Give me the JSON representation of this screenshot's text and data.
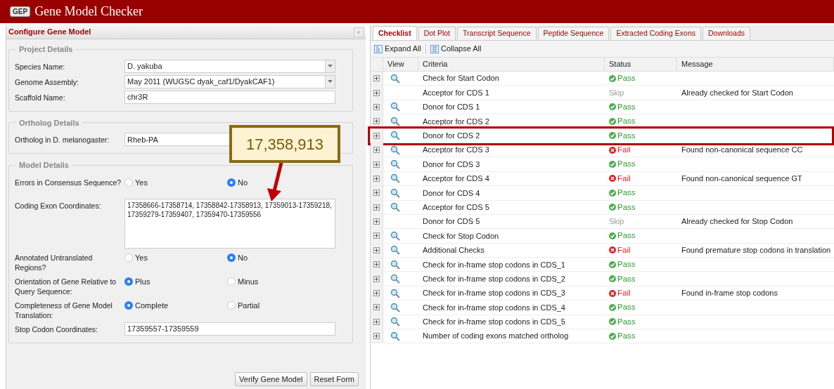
{
  "app": {
    "logo": "GEP",
    "title": "Gene Model Checker"
  },
  "left_panel": {
    "title": "Configure Gene Model",
    "collapse": "«",
    "sections": [
      {
        "legend": "Project Details",
        "fields": [
          {
            "kind": "select",
            "label": "Species Name:",
            "value": "D. yakuba"
          },
          {
            "kind": "select",
            "label": "Genome Assembly:",
            "value": "May 2011 (WUGSC dyak_caf1/DyakCAF1)"
          },
          {
            "kind": "text",
            "label": "Scaffold Name:",
            "value": "chr3R"
          }
        ]
      },
      {
        "legend": "Ortholog Details",
        "fields": [
          {
            "kind": "text",
            "label": "Ortholog in D. melanogaster:",
            "value": "Rheb-PA"
          }
        ]
      },
      {
        "legend": "Model Details",
        "fields": [
          {
            "kind": "radio",
            "label": "Errors in Consensus Sequence?",
            "options": [
              {
                "label": "Yes",
                "selected": false
              },
              {
                "label": "No",
                "selected": true
              }
            ]
          },
          {
            "kind": "textarea",
            "label": "Coding Exon Coordinates:",
            "value": "17358666-17358714, 17358842-17358913, 17359013-17359218, 17359279-17359407, 17359470-17359556"
          },
          {
            "kind": "radio",
            "label": "Annotated Untranslated Regions?",
            "options": [
              {
                "label": "Yes",
                "selected": false
              },
              {
                "label": "No",
                "selected": true
              }
            ]
          },
          {
            "kind": "radio",
            "label": "Orientation of Gene Relative to Query Sequence:",
            "options": [
              {
                "label": "Plus",
                "selected": true
              },
              {
                "label": "Minus",
                "selected": false
              }
            ]
          },
          {
            "kind": "radio",
            "label": "Completeness of Gene Model Translation:",
            "options": [
              {
                "label": "Complete",
                "selected": true
              },
              {
                "label": "Partial",
                "selected": false
              }
            ]
          },
          {
            "kind": "text",
            "label": "Stop Codon Coordinates:",
            "value": "17359557-17359559"
          }
        ]
      }
    ],
    "buttons": [
      "Verify Gene Model",
      "Reset Form"
    ]
  },
  "callout": {
    "text": "17,358,913"
  },
  "tabs": [
    {
      "label": "Checklist",
      "selected": true
    },
    {
      "label": "Dot Plot",
      "selected": false
    },
    {
      "label": "Transcript Sequence",
      "selected": false
    },
    {
      "label": "Peptide Sequence",
      "selected": false
    },
    {
      "label": "Extracted Coding Exons",
      "selected": false
    },
    {
      "label": "Downloads",
      "selected": false
    }
  ],
  "toolbar": [
    "Expand All",
    "Collapse All"
  ],
  "table": {
    "columns": [
      "View",
      "Criteria",
      "Status",
      "Message"
    ],
    "rows": [
      {
        "view": true,
        "criteria": "Check for Start Codon",
        "status": "Pass",
        "kind": "pass",
        "highlighted": false
      },
      {
        "view": false,
        "criteria": "Acceptor for CDS 1",
        "status": "Skip",
        "kind": "skip",
        "message": "Already checked for Start Codon",
        "highlighted": false
      },
      {
        "view": true,
        "criteria": "Donor for CDS 1",
        "status": "Pass",
        "kind": "pass",
        "highlighted": false
      },
      {
        "view": true,
        "criteria": "Acceptor for CDS 2",
        "status": "Pass",
        "kind": "pass",
        "highlighted": false
      },
      {
        "view": true,
        "criteria": "Donor for CDS 2",
        "status": "Pass",
        "kind": "pass",
        "highlighted": true
      },
      {
        "view": true,
        "criteria": "Acceptor for CDS 3",
        "status": "Fail",
        "kind": "fail",
        "message": "Found non-canonical sequence CC",
        "highlighted": false
      },
      {
        "view": true,
        "criteria": "Donor for CDS 3",
        "status": "Pass",
        "kind": "pass",
        "highlighted": false
      },
      {
        "view": true,
        "criteria": "Acceptor for CDS 4",
        "status": "Fail",
        "kind": "fail",
        "message": "Found non-canonical sequence GT",
        "highlighted": false
      },
      {
        "view": true,
        "criteria": "Donor for CDS 4",
        "status": "Pass",
        "kind": "pass",
        "highlighted": false
      },
      {
        "view": true,
        "criteria": "Acceptor for CDS 5",
        "status": "Pass",
        "kind": "pass",
        "highlighted": false
      },
      {
        "view": false,
        "criteria": "Donor for CDS 5",
        "status": "Skip",
        "kind": "skip",
        "message": "Already checked for Stop Codon",
        "highlighted": false
      },
      {
        "view": true,
        "criteria": "Check for Stop Codon",
        "status": "Pass",
        "kind": "pass",
        "highlighted": false
      },
      {
        "view": true,
        "criteria": "Additional Checks",
        "status": "Fail",
        "kind": "fail",
        "message": "Found premature stop codons in translation",
        "highlighted": false
      },
      {
        "view": true,
        "criteria": "Check for in-frame stop codons in CDS_1",
        "status": "Pass",
        "kind": "pass",
        "highlighted": false
      },
      {
        "view": true,
        "criteria": "Check for in-frame stop codons in CDS_2",
        "status": "Pass",
        "kind": "pass",
        "highlighted": false
      },
      {
        "view": true,
        "criteria": "Check for in-frame stop codons in CDS_3",
        "status": "Fail",
        "kind": "fail",
        "message": "Found in-frame stop codons",
        "highlighted": false
      },
      {
        "view": true,
        "criteria": "Check for in-frame stop codons in CDS_4",
        "status": "Pass",
        "kind": "pass",
        "highlighted": false
      },
      {
        "view": true,
        "criteria": "Check for in-frame stop codons in CDS_5",
        "status": "Pass",
        "kind": "pass",
        "highlighted": false
      },
      {
        "view": true,
        "criteria": "Number of coding exons matched ortholog",
        "status": "Pass",
        "kind": "pass",
        "highlighted": false
      }
    ]
  }
}
